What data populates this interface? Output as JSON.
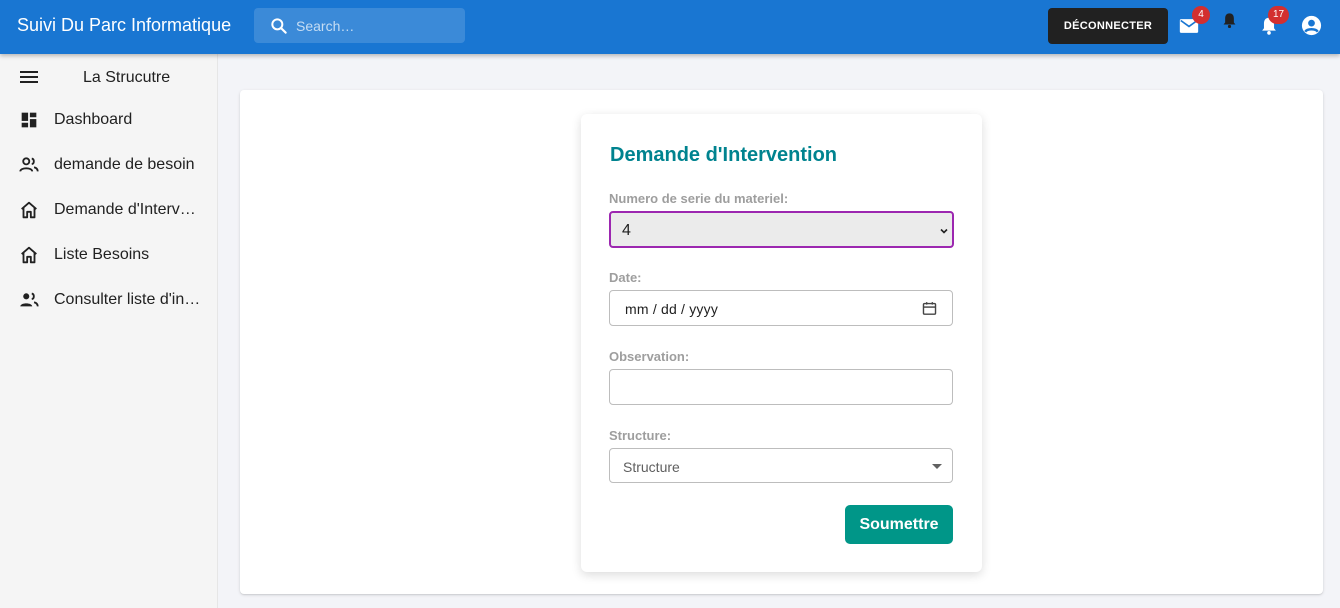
{
  "app": {
    "title": "Suivi Du Parc Informatique",
    "search_placeholder": "Search…",
    "logout_label": "DÉCONNECTER",
    "mail_count": "4",
    "notifications_count": "17",
    "colors": {
      "appbar": "#1976d2",
      "badge": "#d32f2f",
      "title_accent": "#00838f",
      "submit": "#009688",
      "focus_border": "#9c27b0"
    }
  },
  "icons": {
    "search": "search-icon",
    "mail": "mail-icon",
    "bell": "bell-icon",
    "notifications": "notifications-icon",
    "account": "account-circle-icon",
    "menu": "menu-icon",
    "calendar": "calendar-icon"
  },
  "sidebar": {
    "title": "La Strucutre",
    "items": [
      {
        "label": "Dashboard",
        "icon": "dashboard-icon"
      },
      {
        "label": "demande de besoin",
        "icon": "people-icon"
      },
      {
        "label": "Demande d'Intervention",
        "icon": "home-icon"
      },
      {
        "label": "Liste Besoins",
        "icon": "home-icon"
      },
      {
        "label": "Consulter liste d'interventions",
        "icon": "people-icon"
      }
    ]
  },
  "form": {
    "title": "Demande d'Intervention",
    "serial_label": "Numero de serie du materiel:",
    "serial_value": "4",
    "date_label": "Date:",
    "date_value": "mm / dd / yyyy",
    "observation_label": "Observation:",
    "observation_value": "",
    "structure_label": "Structure:",
    "structure_value": "Structure",
    "submit_label": "Soumettre"
  }
}
